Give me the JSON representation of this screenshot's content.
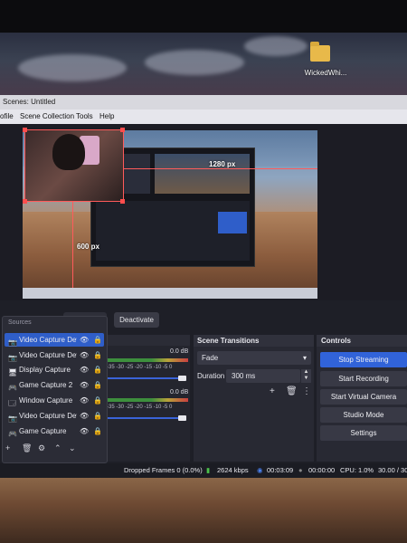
{
  "desktop": {
    "folder_label": "WickedWhi..."
  },
  "window": {
    "title": "Scenes: Untitled"
  },
  "menu": {
    "items": [
      "ofile",
      "Scene Collection",
      "Tools",
      "Help"
    ]
  },
  "preview": {
    "width_readout": "1280 px",
    "height_readout": "600 px"
  },
  "toolbar": {
    "deactivate_label": "Deactivate"
  },
  "sources": {
    "title": "Sources",
    "items": [
      {
        "label": "Video Capture Dev",
        "selected": true
      },
      {
        "label": "Video Capture Dev",
        "selected": false
      },
      {
        "label": "Display Capture",
        "selected": false
      },
      {
        "label": "Game Capture 2",
        "selected": false
      },
      {
        "label": "Window Capture",
        "selected": false
      },
      {
        "label": "Video Capture Dev",
        "selected": false
      },
      {
        "label": "Game Capture",
        "selected": false
      }
    ]
  },
  "mixer": {
    "channels": [
      {
        "db": "0.0 dB",
        "ticks": "-35 -30 -25 -20 -15 -10 -5 0"
      },
      {
        "db": "0.0 dB",
        "ticks": "-35 -30 -25 -20 -15 -10 -5 0"
      }
    ]
  },
  "transitions": {
    "title": "Scene Transitions",
    "selected": "Fade",
    "duration_label": "Duration",
    "duration_value": "300 ms"
  },
  "controls": {
    "title": "Controls",
    "buttons": [
      "Stop Streaming",
      "Start Recording",
      "Start Virtual Camera",
      "Studio Mode",
      "Settings"
    ]
  },
  "status": {
    "dropped_frames": "Dropped Frames 0 (0.0%)",
    "bitrate": "2624 kbps",
    "stream_time": "00:03:09",
    "record_time": "00:00:00",
    "cpu": "CPU: 1.0%",
    "fps": "30.00 / 30"
  },
  "colors": {
    "accent": "#3163d9",
    "selection_outline": "#ff5a5a",
    "panel_bg": "#282933"
  }
}
